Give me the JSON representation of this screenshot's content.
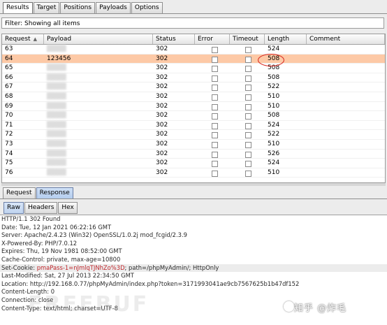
{
  "tabs": [
    "Results",
    "Target",
    "Positions",
    "Payloads",
    "Options"
  ],
  "filter_text": "Filter: Showing all items",
  "columns": [
    "Request",
    "Payload",
    "Status",
    "Error",
    "Timeout",
    "Length",
    "Comment"
  ],
  "rows": [
    {
      "request": "63",
      "payload": "",
      "status": "302",
      "length": "524"
    },
    {
      "request": "64",
      "payload": "123456",
      "status": "302",
      "length": "508"
    },
    {
      "request": "65",
      "payload": "",
      "status": "302",
      "length": "508"
    },
    {
      "request": "66",
      "payload": "",
      "status": "302",
      "length": "508"
    },
    {
      "request": "67",
      "payload": "",
      "status": "302",
      "length": "522"
    },
    {
      "request": "68",
      "payload": "",
      "status": "302",
      "length": "510"
    },
    {
      "request": "69",
      "payload": "",
      "status": "302",
      "length": "510"
    },
    {
      "request": "70",
      "payload": "",
      "status": "302",
      "length": "508"
    },
    {
      "request": "71",
      "payload": "",
      "status": "302",
      "length": "524"
    },
    {
      "request": "72",
      "payload": "",
      "status": "302",
      "length": "522"
    },
    {
      "request": "73",
      "payload": "",
      "status": "302",
      "length": "510"
    },
    {
      "request": "74",
      "payload": "",
      "status": "302",
      "length": "526"
    },
    {
      "request": "75",
      "payload": "",
      "status": "302",
      "length": "524"
    },
    {
      "request": "76",
      "payload": "",
      "status": "302",
      "length": "510"
    }
  ],
  "selected_row": "64",
  "req_resp_tabs": [
    "Request",
    "Response"
  ],
  "view_tabs": [
    "Raw",
    "Headers",
    "Hex"
  ],
  "response": {
    "status_line": "HTTP/1.1 302 Found",
    "date": "Date: Tue, 12 Jan 2021 06:22:16 GMT",
    "server": "Server: Apache/2.4.23 (Win32) OpenSSL/1.0.2j mod_fcgid/2.3.9",
    "powered": "X-Powered-By: PHP/7.0.12",
    "expires": "Expires: Thu, 19 Nov 1981 08:52:00 GMT",
    "cache": "Cache-Control: private, max-age=10800",
    "cookie_label": "Set-Cookie: ",
    "cookie_value": "pmaPass-1=nJmlqTJNhZo%3D",
    "cookie_rest": "; path=/phpMyAdmin/; HttpOnly",
    "last_modified": "Last-Modified: Sat, 27 Jul 2013 22:34:50 GMT",
    "location": "Location: http://192.168.0.77/phpMyAdmin/index.php?token=3171993041ae9cb7567625b1b47df152",
    "content_length": "Content-Length: 0",
    "connection": "Connection: close",
    "content_type": "Content-Type: text/html; charset=UTF-8"
  },
  "watermark": "知乎 @炸毛",
  "bg_watermark": "FREEBUF",
  "accent_color": "#fdc9a6",
  "circle_color": "#d8261e"
}
